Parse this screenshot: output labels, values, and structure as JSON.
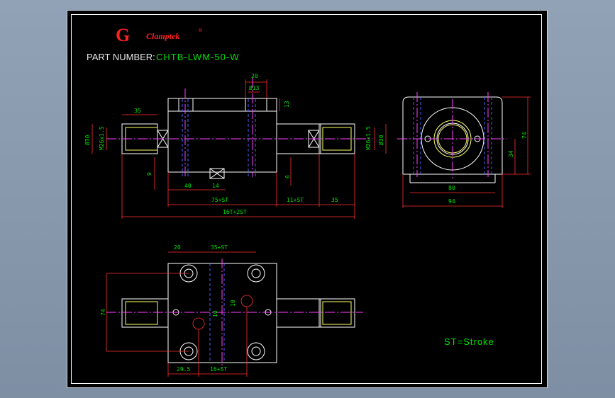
{
  "logo": {
    "mark": "G",
    "text": "Clamptek",
    "reg": "®"
  },
  "part_label": "PART NUMBER:",
  "part_number": "CHTB-LWM-50-W",
  "note": "ST=Stroke",
  "dims": {
    "d20_top": "20",
    "d13": "Ø13",
    "d13v": "13",
    "d35": "35",
    "d30_left": "Ø30",
    "m26_left": "M26x1.5",
    "m26_right": "M26x1.5",
    "d30_right": "Ø30",
    "d9": "9",
    "d6": "6",
    "d40": "40",
    "d14": "14",
    "d75st": "75+ST",
    "d11st": "11+ST",
    "d35b": "35",
    "d161": "16T+2ST",
    "d80": "80",
    "d94": "94",
    "d74_side": "74",
    "d34": "34",
    "d20_plan": "20",
    "d35st": "35+ST",
    "d74_plan": "74",
    "d10a": "10",
    "d10b": "10",
    "d295": "29.5",
    "d16st": "16+ST"
  }
}
